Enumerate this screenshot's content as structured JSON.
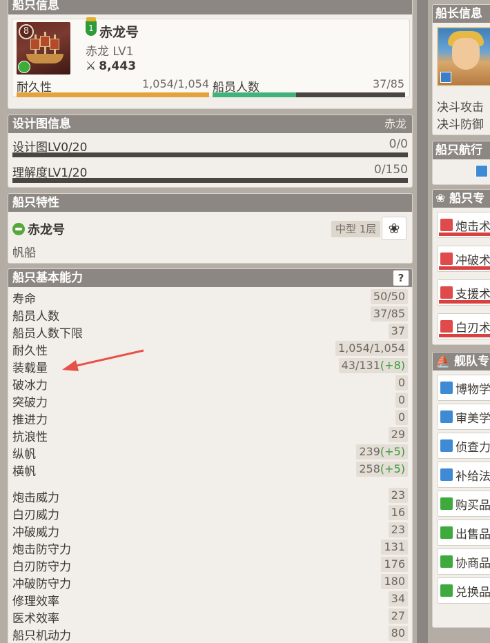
{
  "ship_info": {
    "header": "船只信息",
    "rank": "8",
    "level_badge": "1",
    "name": "赤龙号",
    "type_level": "赤龙 LV1",
    "power": "8,443",
    "durability_label": "耐久性",
    "durability_value": "1,054/1,054",
    "durability_fraction": 1.0,
    "crew_label": "船员人数",
    "crew_value": "37/85",
    "crew_fraction": 0.435
  },
  "blueprint": {
    "header": "设计图信息",
    "header_value": "赤龙",
    "rows": [
      {
        "label": "设计图LV0/20",
        "value": "0/0"
      },
      {
        "label": "理解度LV1/20",
        "value": "0/150"
      }
    ]
  },
  "traits": {
    "header": "船只特性",
    "name": "赤龙号",
    "tag": "中型 1层",
    "desc": "帆船"
  },
  "basic": {
    "header": "船只基本能力",
    "help": "?",
    "stats": [
      {
        "label": "寿命",
        "value": "50/50",
        "bonus": ""
      },
      {
        "label": "船员人数",
        "value": "37/85",
        "bonus": ""
      },
      {
        "label": "船员人数下限",
        "value": "37",
        "bonus": ""
      },
      {
        "label": "耐久性",
        "value": "1,054/1,054",
        "bonus": ""
      },
      {
        "label": "装载量",
        "value": "43/131",
        "bonus": "(+8)"
      },
      {
        "label": "破冰力",
        "value": "0",
        "bonus": ""
      },
      {
        "label": "突破力",
        "value": "0",
        "bonus": ""
      },
      {
        "label": "推进力",
        "value": "0",
        "bonus": ""
      },
      {
        "label": "抗浪性",
        "value": "29",
        "bonus": ""
      },
      {
        "label": "纵帆",
        "value": "239",
        "bonus": "(+5)"
      },
      {
        "label": "横帆",
        "value": "258",
        "bonus": "(+5)"
      },
      {
        "label": "炮击威力",
        "value": "23",
        "bonus": ""
      },
      {
        "label": "白刃威力",
        "value": "16",
        "bonus": ""
      },
      {
        "label": "冲破威力",
        "value": "23",
        "bonus": ""
      },
      {
        "label": "炮击防守力",
        "value": "131",
        "bonus": ""
      },
      {
        "label": "白刃防守力",
        "value": "176",
        "bonus": ""
      },
      {
        "label": "冲破防守力",
        "value": "180",
        "bonus": ""
      },
      {
        "label": "修理效率",
        "value": "34",
        "bonus": ""
      },
      {
        "label": "医术效率",
        "value": "27",
        "bonus": ""
      },
      {
        "label": "船只机动力",
        "value": "80",
        "bonus": ""
      }
    ]
  },
  "right": {
    "captain_header": "船长信息",
    "duel_attack": "决斗攻击",
    "duel_defense": "决斗防御",
    "sail_header": "船只航行",
    "ship_skill_header": "船只专",
    "ship_skills": [
      {
        "label": "炮击术",
        "icon": "red"
      },
      {
        "label": "冲破术",
        "icon": "red"
      },
      {
        "label": "支援术",
        "icon": "red"
      },
      {
        "label": "白刃术",
        "icon": "red"
      }
    ],
    "fleet_header": "舰队专",
    "fleet_skills": [
      {
        "label": "博物学",
        "icon": "blue"
      },
      {
        "label": "审美学",
        "icon": "blue"
      },
      {
        "label": "侦查力",
        "icon": "blue"
      },
      {
        "label": "补给法",
        "icon": "blue"
      },
      {
        "label": "购买品",
        "icon": "green"
      },
      {
        "label": "出售品",
        "icon": "green"
      },
      {
        "label": "协商品",
        "icon": "green"
      },
      {
        "label": "兑换品",
        "icon": "green"
      }
    ]
  },
  "colors": {
    "durability_bar": "#e3a23a",
    "crew_bar": "#3fb37a",
    "annotation_arrow": "#e8504a"
  }
}
